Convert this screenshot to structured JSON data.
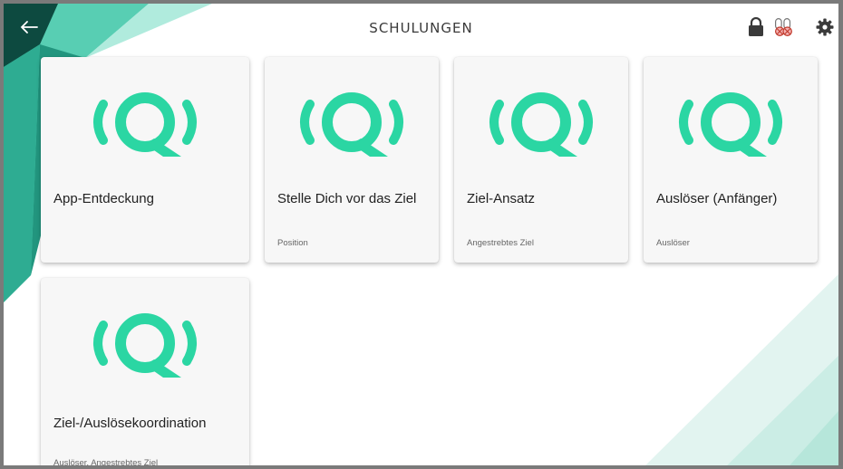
{
  "header": {
    "title": "SCHULUNGEN",
    "back_icon": "arrow-left-icon",
    "lock_icon": "lock-icon",
    "mic_icon": "mic-muted-icon",
    "settings_icon": "gear-icon"
  },
  "colors": {
    "accent": "#2bd6a3",
    "accent_dark": "#1aa383",
    "bg_teal": "#35c9a8",
    "bg_dark": "#0e5c50"
  },
  "cards": [
    {
      "title": "App-Entdeckung",
      "subtitle": ""
    },
    {
      "title": "Stelle Dich vor das Ziel",
      "subtitle": "Position"
    },
    {
      "title": "Ziel-Ansatz",
      "subtitle": "Angestrebtes Ziel"
    },
    {
      "title": "Auslöser (Anfänger)",
      "subtitle": "Auslöser"
    },
    {
      "title": "Ziel-/Auslösekoordination",
      "subtitle": "Auslöser, Angestrebtes Ziel"
    }
  ]
}
